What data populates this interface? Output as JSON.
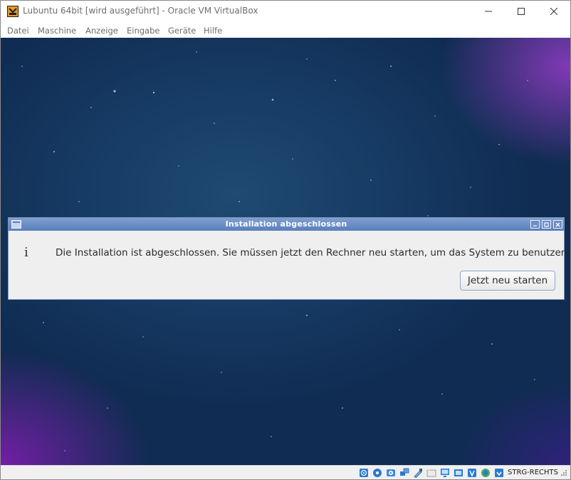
{
  "window": {
    "title": "Lubuntu 64bit [wird ausgeführt] - Oracle VM VirtualBox",
    "icon": "virtualbox-app-icon"
  },
  "menubar": {
    "items": [
      "Datei",
      "Maschine",
      "Anzeige",
      "Eingabe",
      "Geräte",
      "Hilfe"
    ]
  },
  "dialog": {
    "title": "Installation abgeschlossen",
    "info_glyph": "i",
    "message": "Die Installation ist abgeschlossen. Sie müssen jetzt den Rechner neu starten, um das System zu benutzen.",
    "restart_button": "Jetzt neu starten"
  },
  "statusbar": {
    "icons": [
      "hard-disk-icon",
      "optical-drive-icon",
      "audio-icon",
      "network-icon",
      "usb-icon",
      "shared-folders-icon",
      "display-icon",
      "video-capture-icon",
      "virtualization-icon",
      "mouse-integration-icon",
      "keyboard-capture-icon"
    ],
    "host_key": "STRG-RECHTS"
  },
  "colors": {
    "dialog_title_bar": "#6a8cc6",
    "dialog_background": "#efefef",
    "desktop_blue": "#163a63",
    "desktop_purple": "#8a3cc4"
  }
}
